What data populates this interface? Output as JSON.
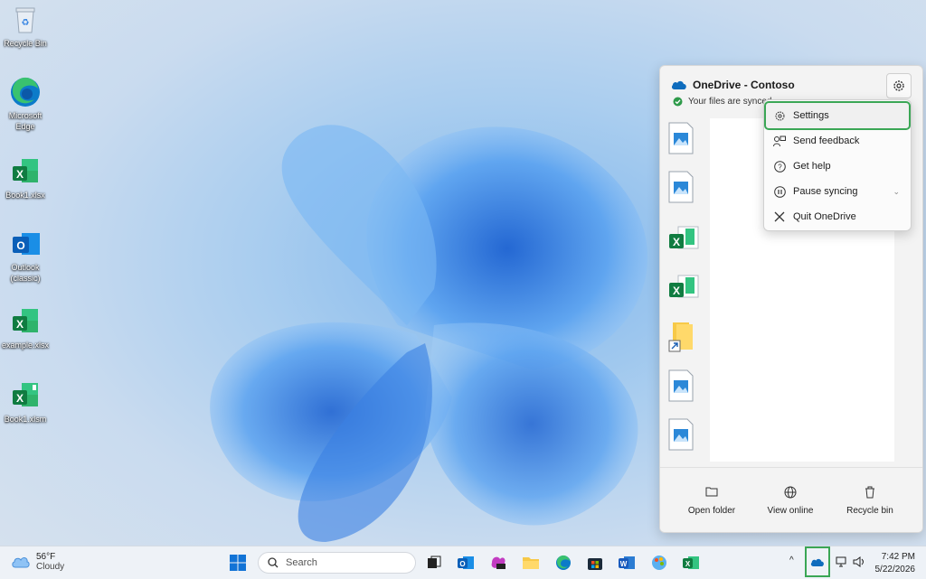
{
  "desktop": {
    "icons": [
      {
        "label": "Recycle Bin",
        "icon": "recycle-bin-icon"
      },
      {
        "label": "Microsoft\nEdge",
        "icon": "edge-icon"
      },
      {
        "label": "Book1.xlsx",
        "icon": "excel-icon"
      },
      {
        "label": "Outlook\n(classic)",
        "icon": "outlook-icon"
      },
      {
        "label": "example.xlsx",
        "icon": "excel-icon"
      },
      {
        "label": "Book1.xlsm",
        "icon": "excel-macro-icon"
      }
    ]
  },
  "onedrive": {
    "title": "OneDrive - Contoso",
    "status": "Your files are synced",
    "footer": {
      "open_folder": "Open folder",
      "view_online": "View online",
      "recycle_bin": "Recycle bin"
    }
  },
  "menu": {
    "items": [
      {
        "label": "Settings",
        "icon": "gear-icon"
      },
      {
        "label": "Send feedback",
        "icon": "feedback-icon"
      },
      {
        "label": "Get help",
        "icon": "help-icon"
      },
      {
        "label": "Pause syncing",
        "icon": "pause-icon"
      },
      {
        "label": "Quit OneDrive",
        "icon": "close-icon"
      }
    ]
  },
  "taskbar": {
    "weather": {
      "temp": "56°F",
      "condition": "Cloudy"
    },
    "search_placeholder": "Search",
    "clock": {
      "time": "7:42 PM",
      "date": "5/22/2026"
    }
  },
  "colors": {
    "highlight": "#3aa655",
    "excel_green": "#1d7a44",
    "onedrive_blue": "#0f6cbd"
  }
}
